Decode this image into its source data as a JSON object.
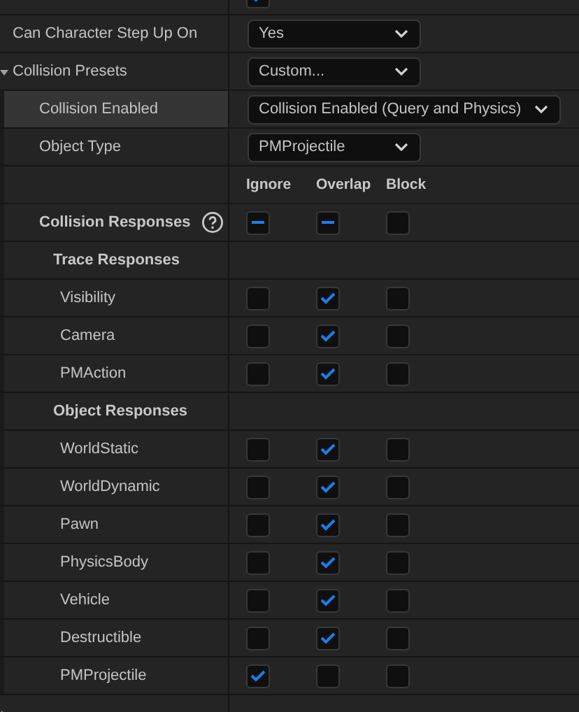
{
  "properties": [
    {
      "kind": "checkbox",
      "checked": true
    },
    {
      "kind": "dropdown",
      "label": "Can Character Step Up On",
      "value": "Yes"
    },
    {
      "kind": "dropdown",
      "label": "Collision Presets",
      "value": "Custom...",
      "expanded": true,
      "children": [
        {
          "kind": "dropdown",
          "label": "Collision Enabled",
          "value": "Collision Enabled (Query and Physics)",
          "wide": true,
          "highlighted": true
        },
        {
          "kind": "dropdown",
          "label": "Object Type",
          "value": "PMProjectile",
          "wide": false,
          "highlighted": false
        },
        {
          "kind": "columns",
          "columns": [
            "Ignore",
            "Overlap",
            "Block"
          ]
        },
        {
          "kind": "responses",
          "label": "Collision Responses",
          "help": true,
          "checks": [
            {
              "mixed": true
            },
            {
              "mixed": true
            },
            {
              "mixed": false
            }
          ],
          "children": [
            {
              "kind": "section",
              "label": "Trace Responses",
              "children": [
                {
                  "kind": "responses",
                  "label": "Visibility",
                  "checks": [
                    {
                      "checked": false
                    },
                    {
                      "checked": true
                    },
                    {
                      "checked": false
                    }
                  ]
                },
                {
                  "kind": "responses",
                  "label": "Camera",
                  "checks": [
                    {
                      "checked": false
                    },
                    {
                      "checked": true
                    },
                    {
                      "checked": false
                    }
                  ]
                },
                {
                  "kind": "responses",
                  "label": "PMAction",
                  "checks": [
                    {
                      "checked": false
                    },
                    {
                      "checked": true
                    },
                    {
                      "checked": false
                    }
                  ]
                }
              ]
            },
            {
              "kind": "section",
              "label": "Object Responses",
              "children": [
                {
                  "kind": "responses",
                  "label": "WorldStatic",
                  "checks": [
                    {
                      "checked": false
                    },
                    {
                      "checked": true
                    },
                    {
                      "checked": false
                    }
                  ]
                },
                {
                  "kind": "responses",
                  "label": "WorldDynamic",
                  "checks": [
                    {
                      "checked": false
                    },
                    {
                      "checked": true
                    },
                    {
                      "checked": false
                    }
                  ]
                },
                {
                  "kind": "responses",
                  "label": "Pawn",
                  "checks": [
                    {
                      "checked": false
                    },
                    {
                      "checked": true
                    },
                    {
                      "checked": false
                    }
                  ]
                },
                {
                  "kind": "responses",
                  "label": "PhysicsBody",
                  "checks": [
                    {
                      "checked": false
                    },
                    {
                      "checked": true
                    },
                    {
                      "checked": false
                    }
                  ]
                },
                {
                  "kind": "responses",
                  "label": "Vehicle",
                  "checks": [
                    {
                      "checked": false
                    },
                    {
                      "checked": true
                    },
                    {
                      "checked": false
                    }
                  ]
                },
                {
                  "kind": "responses",
                  "label": "Destructible",
                  "checks": [
                    {
                      "checked": false
                    },
                    {
                      "checked": true
                    },
                    {
                      "checked": false
                    }
                  ]
                },
                {
                  "kind": "responses",
                  "label": "PMProjectile",
                  "checks": [
                    {
                      "checked": true
                    },
                    {
                      "checked": false
                    },
                    {
                      "checked": false
                    }
                  ]
                }
              ]
            }
          ]
        }
      ]
    },
    {
      "kind": "category",
      "expanded": false
    }
  ]
}
